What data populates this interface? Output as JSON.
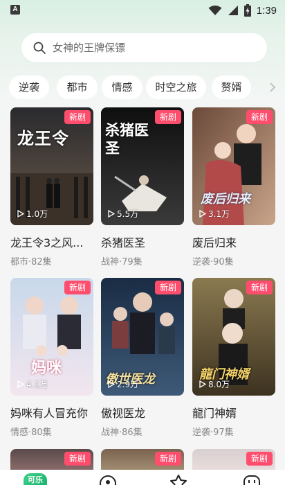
{
  "status_bar": {
    "app_icon_letter": "A",
    "time": "1:39"
  },
  "search": {
    "placeholder": "女神的王牌保镖"
  },
  "categories": [
    "逆袭",
    "都市",
    "情感",
    "时空之旅",
    "赘婿"
  ],
  "dramas": [
    {
      "title": "龙王令3之风...",
      "genre": "都市",
      "episodes": "82集",
      "meta": "都市·82集",
      "views": "1.0万",
      "badge": "新剧",
      "poster_text": "龙王令"
    },
    {
      "title": "杀猪医圣",
      "genre": "战神",
      "episodes": "79集",
      "meta": "战神·79集",
      "views": "5.5万",
      "badge": "新剧",
      "poster_text": "杀猪医圣"
    },
    {
      "title": "废后归来",
      "genre": "逆袭",
      "episodes": "90集",
      "meta": "逆袭·90集",
      "views": "3.1万",
      "badge": "新剧",
      "poster_text": "废后归来"
    },
    {
      "title": "妈咪有人冒充你",
      "genre": "情感",
      "episodes": "80集",
      "meta": "情感·80集",
      "views": "4.1万",
      "badge": "新剧",
      "poster_text": "妈咪"
    },
    {
      "title": "傲视医龙",
      "genre": "战神",
      "episodes": "86集",
      "meta": "战神·86集",
      "views": "2.9万",
      "badge": "新剧",
      "poster_text": "傲世医龙"
    },
    {
      "title": "龍门神婿",
      "genre": "逆袭",
      "episodes": "97集",
      "meta": "逆袭·97集",
      "views": "8.0万",
      "badge": "新剧",
      "poster_text": "龍门神婿"
    }
  ],
  "next_row_badges": [
    "新剧",
    "新剧",
    "新剧"
  ],
  "bottom_nav": {
    "brand_label": "可乐",
    "items": [
      "home-icon",
      "discover-icon",
      "favorites-icon",
      "profile-icon"
    ]
  },
  "colors": {
    "badge": "#ff4d6d",
    "accent_green": "#1fb870",
    "background": "#f5f5f5"
  }
}
